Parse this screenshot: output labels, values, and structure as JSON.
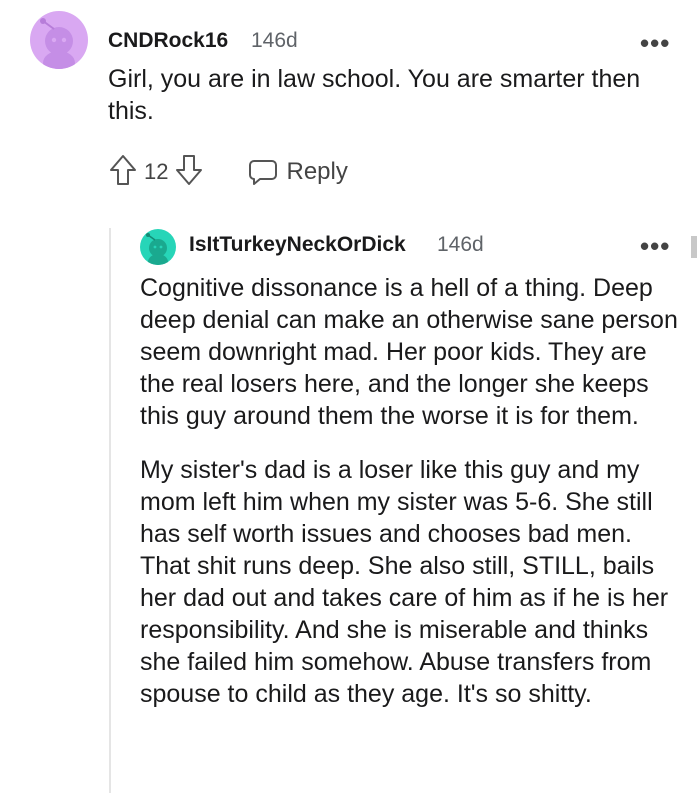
{
  "comment": {
    "author": "CNDRock16",
    "time_ago": "146d",
    "body": "Girl, you are in law school. You are smarter then this.",
    "votes": "12",
    "reply_label": "Reply",
    "more_label": "•••"
  },
  "reply": {
    "author": "IsItTurkeyNeckOrDick",
    "time_ago": "146d",
    "more_label": "•••",
    "paragraphs": [
      "Cognitive dissonance is a hell of a thing. Deep deep denial can make an otherwise sane person seem downright mad. Her poor kids. They are the real losers here, and the longer she keeps this guy around them the worse it is for them.",
      "My sister's dad is a loser like this guy and my mom left him when my sister was 5-6. She still has self worth issues and chooses bad men. That shit runs deep. She also still, STILL, bails her dad out and takes care of him as if he is her responsibility. And she is miserable and thinks she failed him somehow. Abuse transfers from spouse to child as they age. It's so shitty."
    ]
  },
  "icons": {
    "avatar1": "snoo-avatar-purple",
    "avatar2": "snoo-avatar-teal",
    "upvote": "upvote-arrow-icon",
    "downvote": "downvote-arrow-icon",
    "reply": "chat-bubble-icon"
  },
  "colors": {
    "avatar1_bg": "#d9a8f2",
    "avatar2_bg": "#27d5b8",
    "text": "#1a1a1b",
    "meta": "#5f6368"
  }
}
